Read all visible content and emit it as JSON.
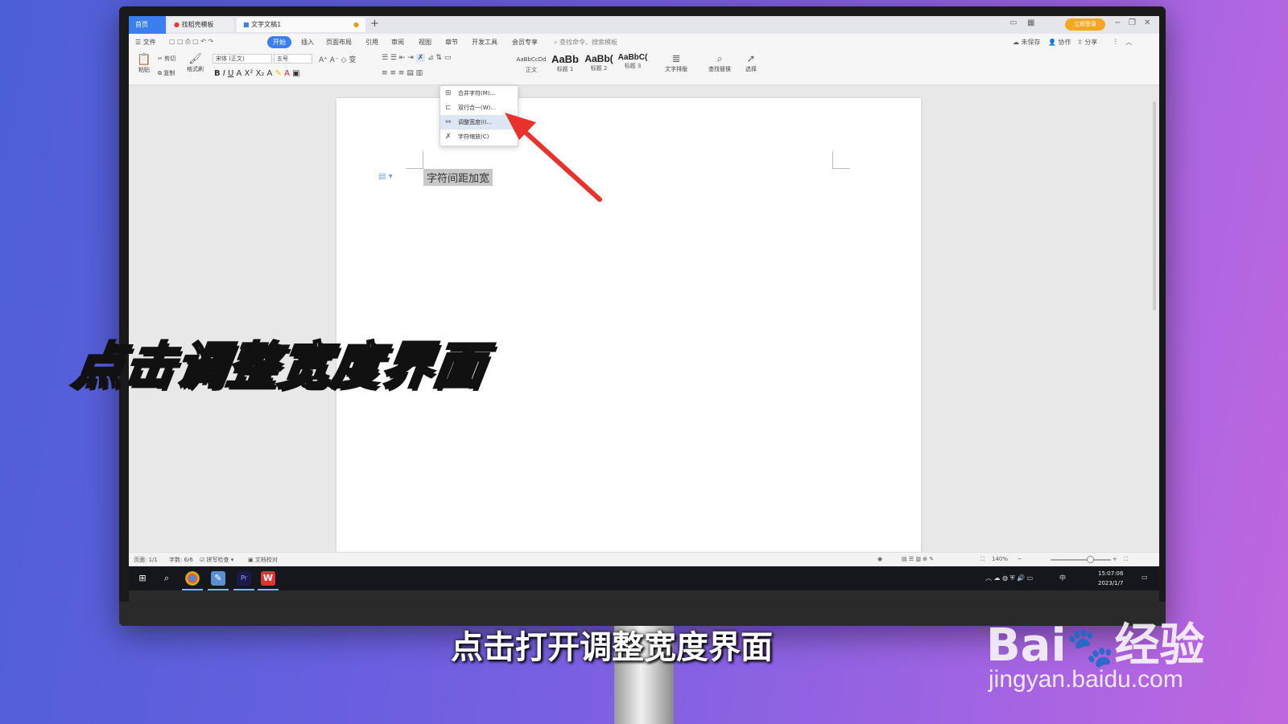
{
  "tabs": {
    "home": "首页",
    "template": "找稻壳模板",
    "document": "文字文稿1",
    "add": "+",
    "login": "立即登录"
  },
  "menu": {
    "file": "文件",
    "start": "开始",
    "insert": "插入",
    "page_layout": "页面布局",
    "reference": "引用",
    "review": "审阅",
    "view": "视图",
    "chapter": "章节",
    "dev_tools": "开发工具",
    "member": "会员专享",
    "search_cmd": "查找命令、搜索模板",
    "unsaved": "未保存",
    "collab": "协作",
    "share": "分享"
  },
  "ribbon": {
    "paste": "粘贴",
    "cut": "剪切",
    "copy": "复制",
    "format_painter": "格式刷",
    "font_name": "宋体 (正文)",
    "font_size": "五号",
    "styles": [
      {
        "preview": "AaBbCcDd",
        "name": "正文"
      },
      {
        "preview": "AaBb",
        "name": "标题 1"
      },
      {
        "preview": "AaBb(",
        "name": "标题 2"
      },
      {
        "preview": "AaBbC(",
        "name": "标题 3"
      }
    ],
    "text_layout": "文字排版",
    "find_replace": "查找替换",
    "select": "选择"
  },
  "dropdown": {
    "items": [
      {
        "label": "合并字符(M)...",
        "icon": "merge-chars-icon"
      },
      {
        "label": "双行合一(W)...",
        "icon": "two-lines-icon"
      },
      {
        "label": "调整宽度(I)...",
        "icon": "adjust-width-icon"
      },
      {
        "label": "字符缩放(C)",
        "icon": "char-scale-icon"
      }
    ]
  },
  "document": {
    "text": "字符间距加宽"
  },
  "status": {
    "page": "页面: 1/1",
    "word_count": "字数: 6/6",
    "spell_check": "拼写检查",
    "doc_proof": "文档校对",
    "zoom": "140%"
  },
  "taskbar": {
    "time": "15:07:06",
    "date": "2023/1/7",
    "ime": "中"
  },
  "overlay": {
    "big_caption": "点击调整宽度界面",
    "subtitle": "点击打开调整宽度界面",
    "watermark_logo": "Bai du 经验",
    "watermark_url": "jingyan.baidu.com"
  },
  "colors": {
    "accent": "#3b7ef0",
    "arrow": "#e8332d",
    "login": "#f5a623"
  }
}
